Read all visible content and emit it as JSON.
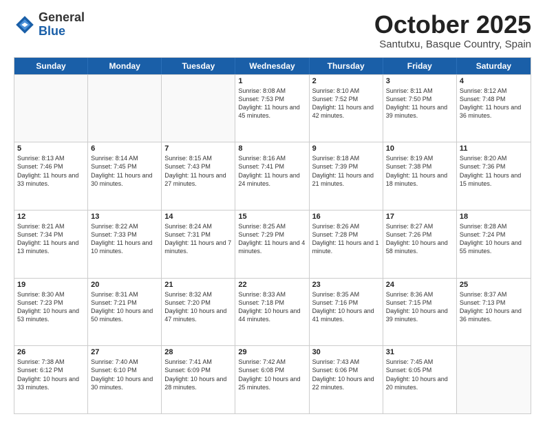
{
  "logo": {
    "general": "General",
    "blue": "Blue"
  },
  "header": {
    "month": "October 2025",
    "location": "Santutxu, Basque Country, Spain"
  },
  "weekdays": [
    "Sunday",
    "Monday",
    "Tuesday",
    "Wednesday",
    "Thursday",
    "Friday",
    "Saturday"
  ],
  "weeks": [
    [
      {
        "day": "",
        "info": ""
      },
      {
        "day": "",
        "info": ""
      },
      {
        "day": "",
        "info": ""
      },
      {
        "day": "1",
        "info": "Sunrise: 8:08 AM\nSunset: 7:53 PM\nDaylight: 11 hours and 45 minutes."
      },
      {
        "day": "2",
        "info": "Sunrise: 8:10 AM\nSunset: 7:52 PM\nDaylight: 11 hours and 42 minutes."
      },
      {
        "day": "3",
        "info": "Sunrise: 8:11 AM\nSunset: 7:50 PM\nDaylight: 11 hours and 39 minutes."
      },
      {
        "day": "4",
        "info": "Sunrise: 8:12 AM\nSunset: 7:48 PM\nDaylight: 11 hours and 36 minutes."
      }
    ],
    [
      {
        "day": "5",
        "info": "Sunrise: 8:13 AM\nSunset: 7:46 PM\nDaylight: 11 hours and 33 minutes."
      },
      {
        "day": "6",
        "info": "Sunrise: 8:14 AM\nSunset: 7:45 PM\nDaylight: 11 hours and 30 minutes."
      },
      {
        "day": "7",
        "info": "Sunrise: 8:15 AM\nSunset: 7:43 PM\nDaylight: 11 hours and 27 minutes."
      },
      {
        "day": "8",
        "info": "Sunrise: 8:16 AM\nSunset: 7:41 PM\nDaylight: 11 hours and 24 minutes."
      },
      {
        "day": "9",
        "info": "Sunrise: 8:18 AM\nSunset: 7:39 PM\nDaylight: 11 hours and 21 minutes."
      },
      {
        "day": "10",
        "info": "Sunrise: 8:19 AM\nSunset: 7:38 PM\nDaylight: 11 hours and 18 minutes."
      },
      {
        "day": "11",
        "info": "Sunrise: 8:20 AM\nSunset: 7:36 PM\nDaylight: 11 hours and 15 minutes."
      }
    ],
    [
      {
        "day": "12",
        "info": "Sunrise: 8:21 AM\nSunset: 7:34 PM\nDaylight: 11 hours and 13 minutes."
      },
      {
        "day": "13",
        "info": "Sunrise: 8:22 AM\nSunset: 7:33 PM\nDaylight: 11 hours and 10 minutes."
      },
      {
        "day": "14",
        "info": "Sunrise: 8:24 AM\nSunset: 7:31 PM\nDaylight: 11 hours and 7 minutes."
      },
      {
        "day": "15",
        "info": "Sunrise: 8:25 AM\nSunset: 7:29 PM\nDaylight: 11 hours and 4 minutes."
      },
      {
        "day": "16",
        "info": "Sunrise: 8:26 AM\nSunset: 7:28 PM\nDaylight: 11 hours and 1 minute."
      },
      {
        "day": "17",
        "info": "Sunrise: 8:27 AM\nSunset: 7:26 PM\nDaylight: 10 hours and 58 minutes."
      },
      {
        "day": "18",
        "info": "Sunrise: 8:28 AM\nSunset: 7:24 PM\nDaylight: 10 hours and 55 minutes."
      }
    ],
    [
      {
        "day": "19",
        "info": "Sunrise: 8:30 AM\nSunset: 7:23 PM\nDaylight: 10 hours and 53 minutes."
      },
      {
        "day": "20",
        "info": "Sunrise: 8:31 AM\nSunset: 7:21 PM\nDaylight: 10 hours and 50 minutes."
      },
      {
        "day": "21",
        "info": "Sunrise: 8:32 AM\nSunset: 7:20 PM\nDaylight: 10 hours and 47 minutes."
      },
      {
        "day": "22",
        "info": "Sunrise: 8:33 AM\nSunset: 7:18 PM\nDaylight: 10 hours and 44 minutes."
      },
      {
        "day": "23",
        "info": "Sunrise: 8:35 AM\nSunset: 7:16 PM\nDaylight: 10 hours and 41 minutes."
      },
      {
        "day": "24",
        "info": "Sunrise: 8:36 AM\nSunset: 7:15 PM\nDaylight: 10 hours and 39 minutes."
      },
      {
        "day": "25",
        "info": "Sunrise: 8:37 AM\nSunset: 7:13 PM\nDaylight: 10 hours and 36 minutes."
      }
    ],
    [
      {
        "day": "26",
        "info": "Sunrise: 7:38 AM\nSunset: 6:12 PM\nDaylight: 10 hours and 33 minutes."
      },
      {
        "day": "27",
        "info": "Sunrise: 7:40 AM\nSunset: 6:10 PM\nDaylight: 10 hours and 30 minutes."
      },
      {
        "day": "28",
        "info": "Sunrise: 7:41 AM\nSunset: 6:09 PM\nDaylight: 10 hours and 28 minutes."
      },
      {
        "day": "29",
        "info": "Sunrise: 7:42 AM\nSunset: 6:08 PM\nDaylight: 10 hours and 25 minutes."
      },
      {
        "day": "30",
        "info": "Sunrise: 7:43 AM\nSunset: 6:06 PM\nDaylight: 10 hours and 22 minutes."
      },
      {
        "day": "31",
        "info": "Sunrise: 7:45 AM\nSunset: 6:05 PM\nDaylight: 10 hours and 20 minutes."
      },
      {
        "day": "",
        "info": ""
      }
    ]
  ]
}
